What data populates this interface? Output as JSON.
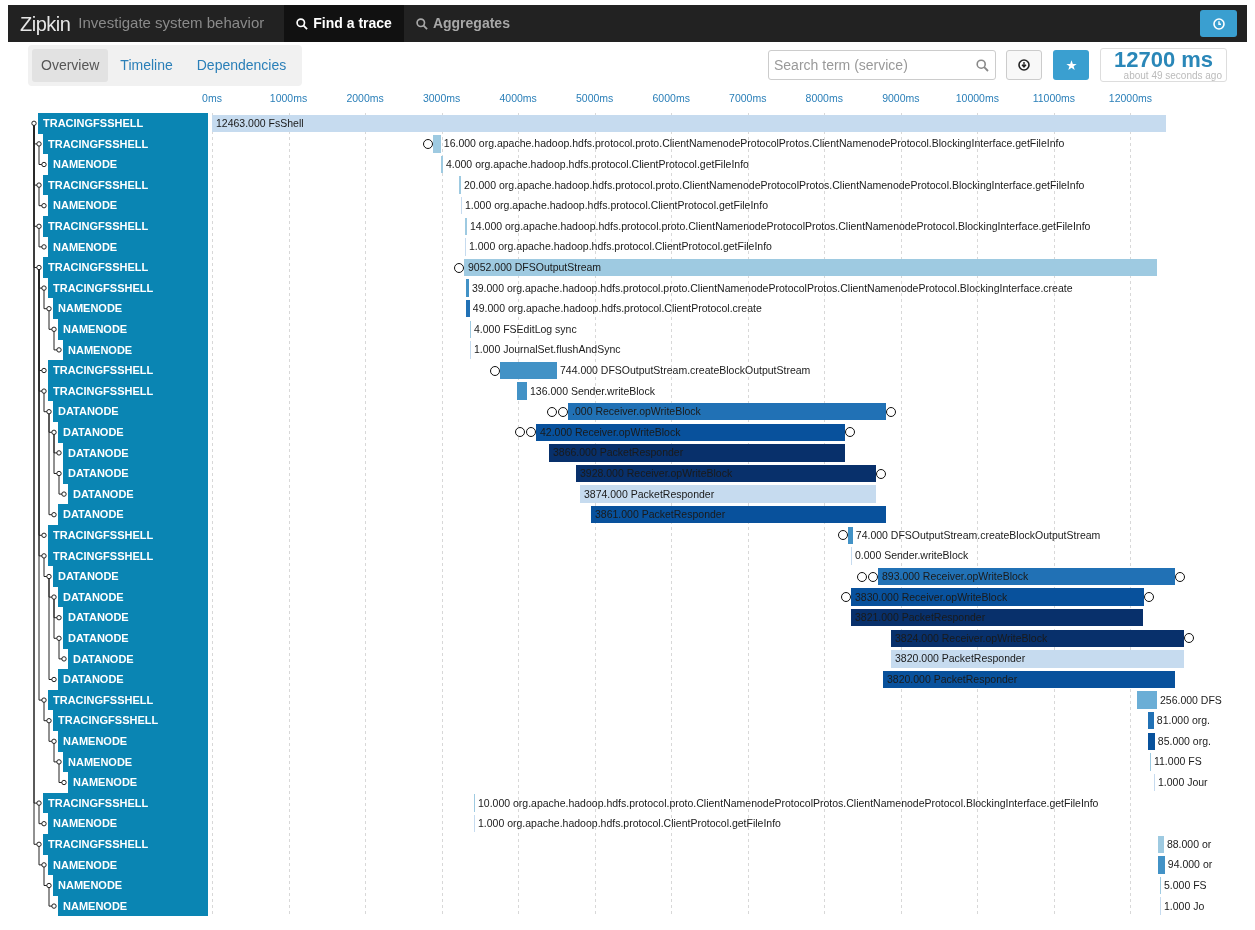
{
  "header": {
    "brand": "Zipkin",
    "tagline": "Investigate system behavior",
    "nav": [
      {
        "label": "Find a trace",
        "selected": true
      },
      {
        "label": "Aggregates",
        "selected": false
      }
    ]
  },
  "subnav": {
    "tabs": [
      {
        "label": "Overview",
        "selected": true
      },
      {
        "label": "Timeline",
        "selected": false
      },
      {
        "label": "Dependencies",
        "selected": false
      }
    ],
    "search": {
      "placeholder": "Search term (service)"
    },
    "duration": "12700 ms",
    "age": "about 49 seconds ago"
  },
  "axis": {
    "ticks": [
      "0ms",
      "1000ms",
      "2000ms",
      "3000ms",
      "4000ms",
      "5000ms",
      "6000ms",
      "7000ms",
      "8000ms",
      "9000ms",
      "10000ms",
      "11000ms",
      "12000ms"
    ]
  },
  "spans": [
    {
      "service": "TRACINGFSSHELL",
      "label": "12463.000 FsShell",
      "color": "#c6dbef",
      "children": [
        {
          "service": "TRACINGFSSHELL",
          "label": "16.000 org.apache.hadoop.hdfs.protocol.proto.ClientNamenodeProtocolProtos.ClientNamenodeProtocol.BlockingInterface.getFileInfo",
          "color": "#9ecae1",
          "start_annotation": true,
          "children": [
            {
              "service": "NAMENODE",
              "label": "4.000 org.apache.hadoop.hdfs.protocol.ClientProtocol.getFileInfo",
              "color": "#9ecae1"
            }
          ]
        },
        {
          "service": "TRACINGFSSHELL",
          "label": "20.000 org.apache.hadoop.hdfs.protocol.proto.ClientNamenodeProtocolProtos.ClientNamenodeProtocol.BlockingInterface.getFileInfo",
          "color": "#9ecae1",
          "children": [
            {
              "service": "NAMENODE",
              "label": "1.000 org.apache.hadoop.hdfs.protocol.ClientProtocol.getFileInfo",
              "color": "#c6dbef"
            }
          ]
        },
        {
          "service": "TRACINGFSSHELL",
          "label": "14.000 org.apache.hadoop.hdfs.protocol.proto.ClientNamenodeProtocolProtos.ClientNamenodeProtocol.BlockingInterface.getFileInfo",
          "color": "#9ecae1",
          "children": [
            {
              "service": "NAMENODE",
              "label": "1.000 org.apache.hadoop.hdfs.protocol.ClientProtocol.getFileInfo",
              "color": "#c6dbef"
            }
          ]
        },
        {
          "service": "TRACINGFSSHELL",
          "label": "9052.000 DFSOutputStream",
          "color": "#9ecae1",
          "start_annotation": true,
          "children": [
            {
              "service": "TRACINGFSSHELL",
              "label": "39.000 org.apache.hadoop.hdfs.protocol.proto.ClientNamenodeProtocolProtos.ClientNamenodeProtocol.BlockingInterface.create",
              "color": "#4292c6",
              "children": [
                {
                  "service": "NAMENODE",
                  "label": "49.000 org.apache.hadoop.hdfs.protocol.ClientProtocol.create",
                  "color": "#2171b5",
                  "children": [
                    {
                      "service": "NAMENODE",
                      "label": "4.000 FSEditLog sync",
                      "color": "#9ecae1",
                      "children": [
                        {
                          "service": "NAMENODE",
                          "label": "1.000 JournalSet.flushAndSync",
                          "color": "#c6dbef"
                        }
                      ]
                    }
                  ]
                }
              ]
            },
            {
              "service": "TRACINGFSSHELL",
              "label": "744.000 DFSOutputStream.createBlockOutputStream",
              "color": "#4292c6",
              "start_annotation": true
            },
            {
              "service": "TRACINGFSSHELL",
              "label": "136.000 Sender.writeBlock",
              "color": "#4292c6",
              "children": [
                {
                  "service": "DATANODE",
                  "label": ".000 Receiver.opWriteBlock",
                  "color": "#2171b5",
                  "start_annotation": true,
                  "end_annotation": true,
                  "children": [
                    {
                      "service": "DATANODE",
                      "label": "42.000 Receiver.opWriteBlock",
                      "color": "#08519c",
                      "start_annotation": true,
                      "end_annotation": true,
                      "children": [
                        {
                          "service": "DATANODE",
                          "label": "3866.000 PacketResponder",
                          "color": "#08306b"
                        },
                        {
                          "service": "DATANODE",
                          "label": "3928.000 Receiver.opWriteBlock",
                          "color": "#08306b",
                          "end_annotation": true,
                          "children": [
                            {
                              "service": "DATANODE",
                              "label": "3874.000 PacketResponder",
                              "color": "#c6dbef"
                            }
                          ]
                        }
                      ]
                    },
                    {
                      "service": "DATANODE",
                      "label": "3861.000 PacketResponder",
                      "color": "#08519c"
                    }
                  ]
                }
              ]
            },
            {
              "service": "TRACINGFSSHELL",
              "label": "74.000 DFSOutputStream.createBlockOutputStream",
              "color": "#4292c6",
              "start_annotation": true
            },
            {
              "service": "TRACINGFSSHELL",
              "label": "0.000 Sender.writeBlock",
              "color": "#c6dbef",
              "children": [
                {
                  "service": "DATANODE",
                  "label": "893.000 Receiver.opWriteBlock",
                  "color": "#2171b5",
                  "start_annotation": true,
                  "end_annotation": true,
                  "children": [
                    {
                      "service": "DATANODE",
                      "label": "3830.000 Receiver.opWriteBlock",
                      "color": "#08519c",
                      "start_annotation": true,
                      "end_annotation": true,
                      "children": [
                        {
                          "service": "DATANODE",
                          "label": "3821.000 PacketResponder",
                          "color": "#08306b"
                        },
                        {
                          "service": "DATANODE",
                          "label": "3824.000 Receiver.opWriteBlock",
                          "color": "#08306b",
                          "end_annotation": true,
                          "children": [
                            {
                              "service": "DATANODE",
                              "label": "3820.000 PacketResponder",
                              "color": "#c6dbef"
                            }
                          ]
                        }
                      ]
                    },
                    {
                      "service": "DATANODE",
                      "label": "3820.000 PacketResponder",
                      "color": "#08519c"
                    }
                  ]
                }
              ]
            },
            {
              "service": "TRACINGFSSHELL",
              "label": "256.000 DFS",
              "color": "#6baed6",
              "children": [
                {
                  "service": "TRACINGFSSHELL",
                  "label": "81.000 org.",
                  "color": "#2171b5",
                  "children": [
                    {
                      "service": "NAMENODE",
                      "label": "85.000 org.",
                      "color": "#08519c",
                      "children": [
                        {
                          "service": "NAMENODE",
                          "label": "11.000 FS",
                          "color": "#9ecae1",
                          "children": [
                            {
                              "service": "NAMENODE",
                              "label": "1.000 Jour",
                              "color": "#c6dbef"
                            }
                          ]
                        }
                      ]
                    }
                  ]
                }
              ]
            }
          ]
        },
        {
          "service": "TRACINGFSSHELL",
          "label": "10.000 org.apache.hadoop.hdfs.protocol.proto.ClientNamenodeProtocolProtos.ClientNamenodeProtocol.BlockingInterface.getFileInfo",
          "color": "#9ecae1",
          "children": [
            {
              "service": "NAMENODE",
              "label": "1.000 org.apache.hadoop.hdfs.protocol.ClientProtocol.getFileInfo",
              "color": "#c6dbef"
            }
          ]
        },
        {
          "service": "TRACINGFSSHELL",
          "label": "88.000 or",
          "color": "#9ecae1",
          "children": [
            {
              "service": "NAMENODE",
              "label": "94.000 or",
              "color": "#4292c6",
              "children": [
                {
                  "service": "NAMENODE",
                  "label": "5.000 FS",
                  "color": "#9ecae1",
                  "children": [
                    {
                      "service": "NAMENODE",
                      "label": "1.000 Jo",
                      "color": "#c6dbef"
                    }
                  ]
                }
              ]
            }
          ]
        }
      ]
    }
  ]
}
